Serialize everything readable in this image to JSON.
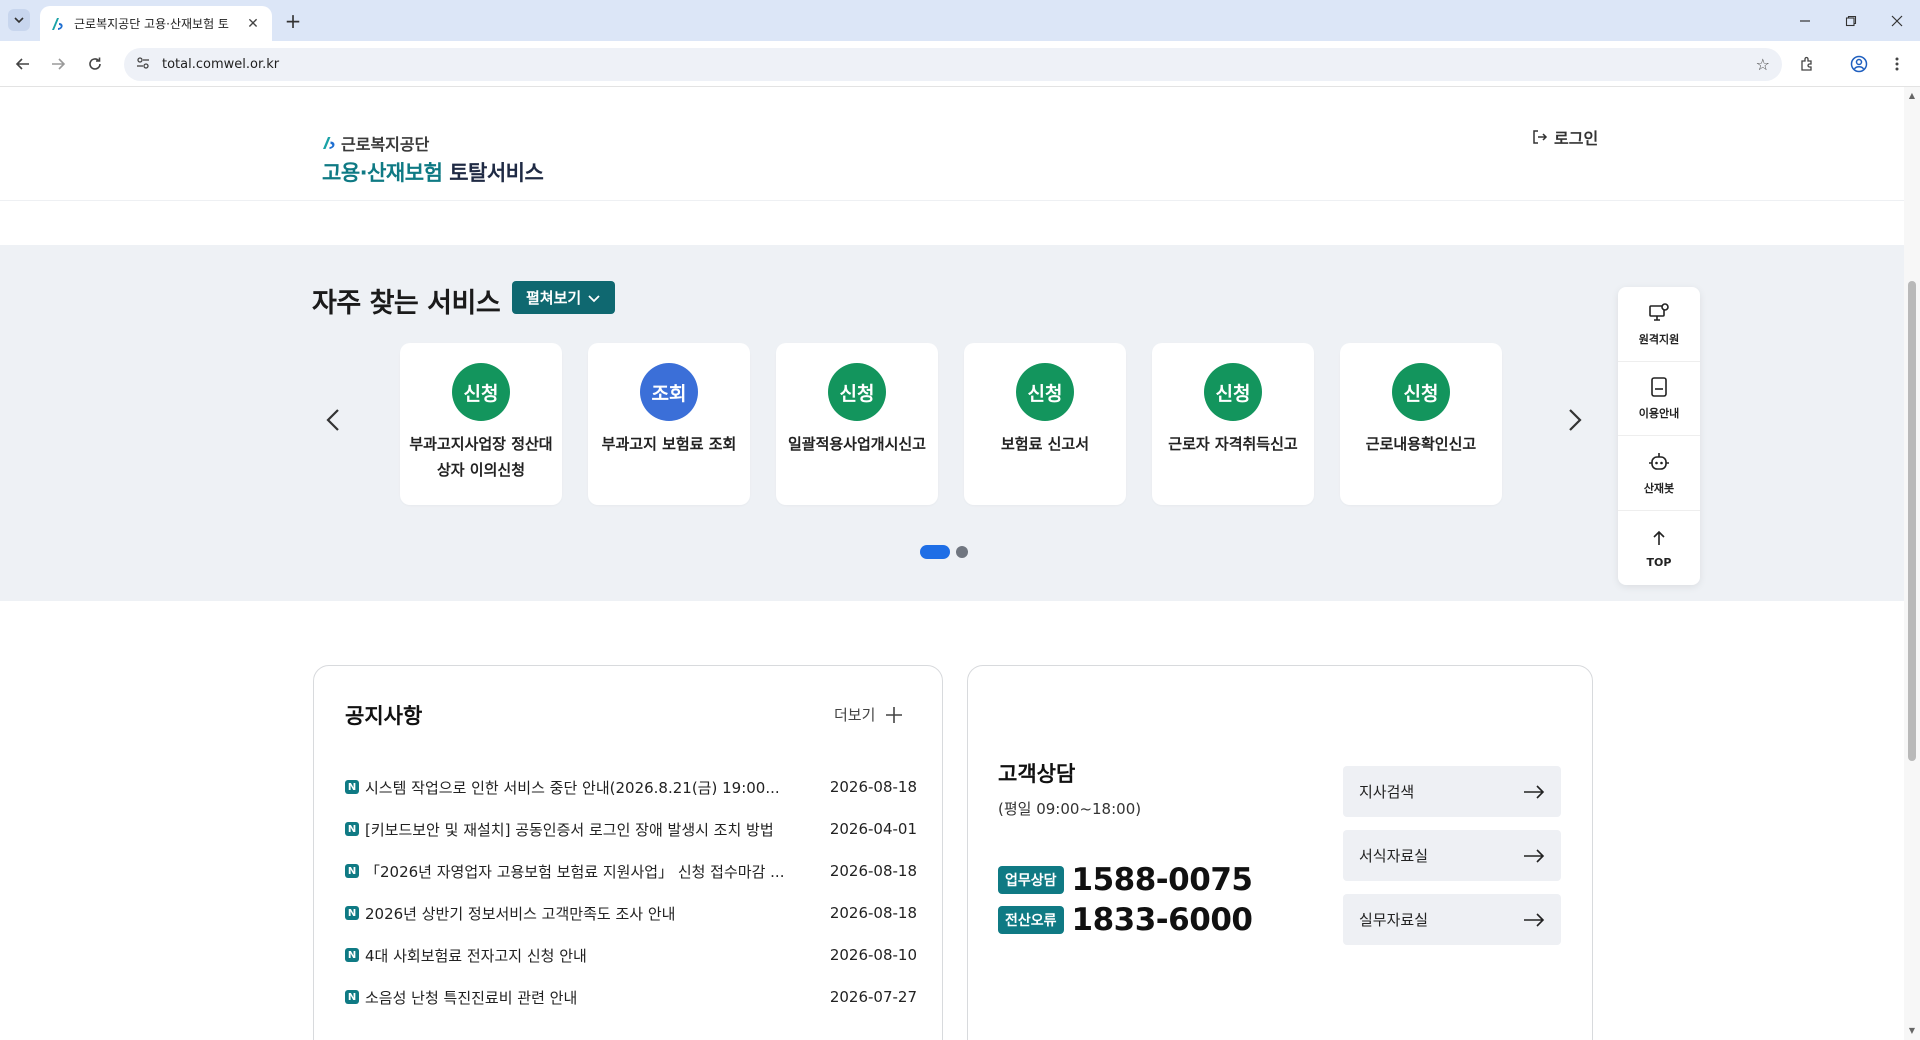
{
  "browser": {
    "tab_title": "근로복지공단 고용·산재보험 토",
    "new_tab_symbol": "+",
    "url": "total.comwel.or.kr"
  },
  "header": {
    "logo_top": "근로복지공단",
    "logo_green": "고용·산재보험",
    "logo_dark": "토탈서비스",
    "login_label": "로그인"
  },
  "services": {
    "title": "자주 찾는 서비스",
    "expand_label": "펼쳐보기",
    "cards": [
      {
        "badge": "신청",
        "label": "부과고지사업장 정산대상자 이의신청",
        "color": "#13955d"
      },
      {
        "badge": "조회",
        "label": "부과고지 보험료 조회",
        "color": "#3b6fd8"
      },
      {
        "badge": "신청",
        "label": "일괄적용사업개시신고",
        "color": "#13955d"
      },
      {
        "badge": "신청",
        "label": "보험료 신고서",
        "color": "#13955d"
      },
      {
        "badge": "신청",
        "label": "근로자 자격취득신고",
        "color": "#13955d"
      },
      {
        "badge": "신청",
        "label": "근로내용확인신고",
        "color": "#13955d"
      }
    ]
  },
  "quick_menu": [
    {
      "label": "원격지원",
      "icon": "remote-support-icon"
    },
    {
      "label": "이용안내",
      "icon": "guide-icon"
    },
    {
      "label": "산재봇",
      "icon": "robot-icon"
    },
    {
      "label": "TOP",
      "icon": "arrow-up-icon"
    }
  ],
  "notice": {
    "title": "공지사항",
    "more_label": "더보기",
    "badge": "N",
    "items": [
      {
        "text": "시스템 작업으로 인한 서비스 중단 안내(2026.8.21(금) 19:00...",
        "date": "2026-08-18"
      },
      {
        "text": "[키보드보안 및 재설치] 공동인증서 로그인 장애 발생시 조치 방법",
        "date": "2026-04-01"
      },
      {
        "text": "「2026년 자영업자 고용보험 보험료 지원사업」 신청 접수마감 ...",
        "date": "2026-08-18"
      },
      {
        "text": "2026년 상반기 정보서비스 고객만족도 조사 안내",
        "date": "2026-08-18"
      },
      {
        "text": "4대 사회보험료 전자고지 신청 안내",
        "date": "2026-08-10"
      },
      {
        "text": "소음성 난청 특진진료비 관련 안내",
        "date": "2026-07-27"
      }
    ]
  },
  "customer_service": {
    "title": "고객상담",
    "hours": "(평일 09:00~18:00)",
    "lines": [
      {
        "badge": "업무상담",
        "number": "1588-0075"
      },
      {
        "badge": "전산오류",
        "number": "1833-6000"
      }
    ],
    "links": [
      {
        "label": "지사검색"
      },
      {
        "label": "서식자료실"
      },
      {
        "label": "실무자료실"
      }
    ]
  }
}
